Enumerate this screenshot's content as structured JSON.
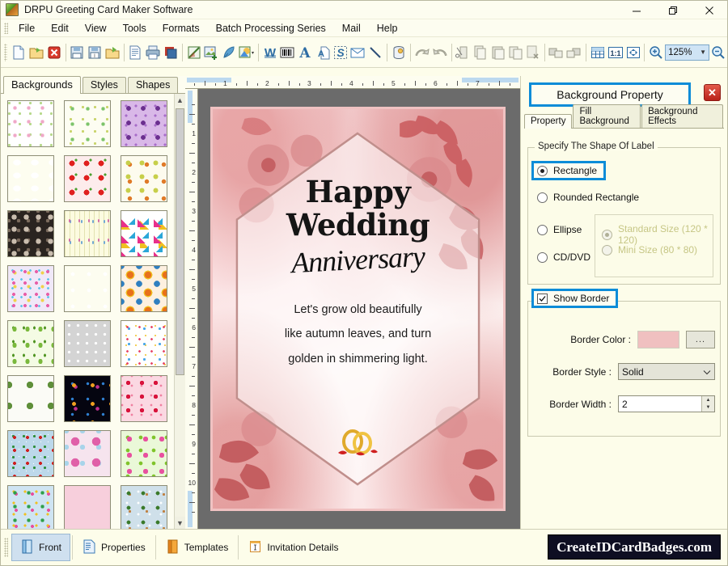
{
  "window": {
    "title": "DRPU Greeting Card Maker Software",
    "icon": "app-icon",
    "controls": {
      "minimize": "minimize-icon",
      "maximize": "maximize-icon",
      "close": "close-icon"
    }
  },
  "menubar": {
    "items": [
      "File",
      "Edit",
      "View",
      "Tools",
      "Formats",
      "Batch Processing Series",
      "Mail",
      "Help"
    ]
  },
  "toolbar": {
    "groups": [
      [
        "new-document-icon",
        "open-folder-icon",
        "delete-red-x-icon"
      ],
      [
        "save-icon",
        "save-as-icon",
        "open-template-icon"
      ],
      [
        "preview-icon",
        "print-icon",
        "print-layers-icon"
      ],
      [
        "pen-draw-icon",
        "add-image-icon",
        "quill-icon",
        "shape-picker-icon"
      ],
      [
        "watermark-icon",
        "barcode-icon",
        "text-icon",
        "text-box-icon",
        "signature-icon",
        "email-icon",
        "line-icon"
      ],
      [
        "database-icon"
      ],
      [
        "undo-icon",
        "redo-icon"
      ],
      [
        "cut-icon",
        "copy-icon",
        "paste-icon",
        "duplicate-icon",
        "delete-object-icon"
      ],
      [
        "bring-front-icon",
        "send-back-icon"
      ],
      [
        "grid-icon",
        "actual-size-icon",
        "fit-page-icon"
      ],
      [
        "zoom-in-icon",
        "zoom-combo",
        "zoom-out-icon"
      ]
    ],
    "zoom_value": "125%"
  },
  "left_panel": {
    "tabs": [
      {
        "label": "Backgrounds",
        "active": true
      },
      {
        "label": "Styles",
        "active": false
      },
      {
        "label": "Shapes",
        "active": false
      }
    ],
    "scrollbar": {
      "up": "scroll-up-arrow-icon",
      "down": "scroll-down-arrow-icon"
    },
    "thumbnails": [
      "baby-doodles-white",
      "baby-alphabet-pastel",
      "purple-floral-bursts",
      "blue-sky-clouds",
      "red-strawberries",
      "green-yellow-leaves",
      "dark-stones-mosaic",
      "pastel-flower-stems-cream",
      "colorful-gift-boxes",
      "multicolor-small-flowers",
      "blue-snowflakes",
      "orange-mandala-circles",
      "green-pine-trees",
      "white-hearts-grey",
      "birthday-kids-confetti",
      "green-pinecones-white",
      "fireworks-black",
      "red-pink-hearts",
      "santa-christmas-blue",
      "pink-glitter-baubles",
      "green-pink-lilies",
      "colorful-stars-blue",
      "plain-pink-texture",
      "snowman-winter-scene"
    ]
  },
  "canvas": {
    "h_ruler_ticks": [
      "1",
      "2",
      "3",
      "4",
      "5",
      "6",
      "7"
    ],
    "v_ruler_ticks": [
      "1",
      "2",
      "3",
      "4",
      "5",
      "6",
      "7",
      "8",
      "9",
      "10"
    ],
    "card": {
      "line1": "Happy",
      "line2": "Wedding",
      "line3": "Anniversary",
      "body": [
        "Let's grow old beautifully",
        "like autumn leaves, and turn",
        "golden in shimmering light."
      ],
      "decor": "floral-watercolor-frame",
      "ornament": "wedding-rings-icon",
      "border_color": "#f0c2c2"
    }
  },
  "right_panel": {
    "title": "Background Property",
    "close_icon": "close-icon",
    "tabs": [
      {
        "label": "Property",
        "active": true
      },
      {
        "label": "Fill Background",
        "active": false
      },
      {
        "label": "Background Effects",
        "active": false
      }
    ],
    "shape_group": {
      "legend": "Specify The Shape Of Label",
      "options": [
        {
          "label": "Rectangle",
          "selected": true,
          "highlighted": true,
          "disabled": false
        },
        {
          "label": "Rounded Rectangle",
          "selected": false,
          "highlighted": false,
          "disabled": false
        },
        {
          "label": "Ellipse",
          "selected": false,
          "highlighted": false,
          "disabled": false
        },
        {
          "label": "CD/DVD",
          "selected": false,
          "highlighted": false,
          "disabled": false
        }
      ],
      "size_options": [
        {
          "label": "Standard Size (120 * 120)",
          "selected": true,
          "disabled": true
        },
        {
          "label": "Mini Size (80 * 80)",
          "selected": false,
          "disabled": true
        }
      ]
    },
    "border_group": {
      "show_border": {
        "label": "Show Border",
        "checked": true,
        "highlighted": true
      },
      "color_label": "Border Color :",
      "color_value": "#f0c0c0",
      "color_browse": "...",
      "style_label": "Border Style :",
      "style_value": "Solid",
      "width_label": "Border Width :",
      "width_value": "2"
    }
  },
  "bottom_bar": {
    "buttons": [
      {
        "label": "Front",
        "icon": "front-card-icon",
        "active": true
      },
      {
        "label": "Properties",
        "icon": "properties-icon",
        "active": false
      },
      {
        "label": "Templates",
        "icon": "templates-icon",
        "active": false
      },
      {
        "label": "Invitation Details",
        "icon": "invitation-details-icon",
        "active": false
      }
    ],
    "brand": "CreateIDCardBadges.com"
  },
  "colors": {
    "accent_highlight": "#0c8cd8",
    "panel_bg": "#fdfdea",
    "canvas_bg": "#6b6b6b",
    "brand_bg": "#0e0e22"
  }
}
